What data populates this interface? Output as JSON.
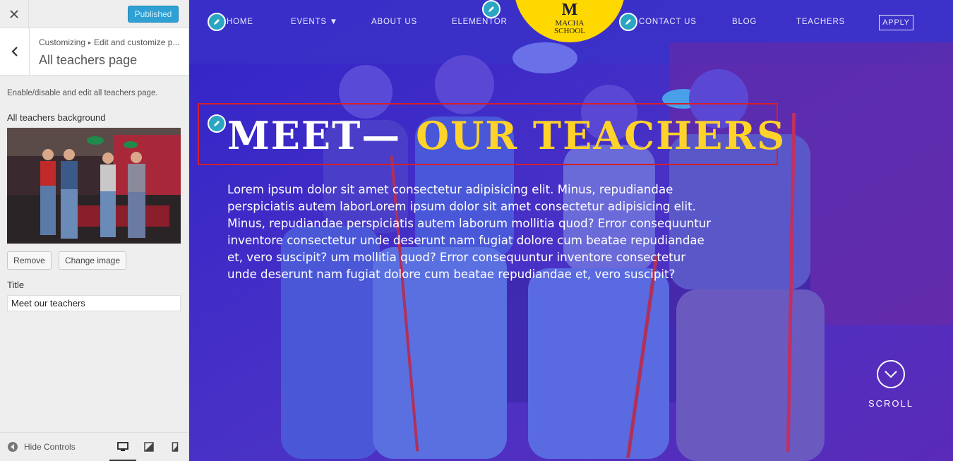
{
  "customizer": {
    "close_icon": "close-icon",
    "publish_label": "Published",
    "breadcrumb_root": "Customizing",
    "breadcrumb_current": "Edit and customize p...",
    "section_title": "All teachers page",
    "description": "Enable/disable and edit all teachers page.",
    "background_label": "All teachers background",
    "remove_label": "Remove",
    "change_label": "Change image",
    "title_label": "Title",
    "title_value": "Meet our teachers",
    "hide_controls_label": "Hide Controls",
    "devices": [
      "desktop",
      "tablet",
      "mobile"
    ]
  },
  "site": {
    "nav": {
      "home": "HOME",
      "events": "EVENTS ▼",
      "about": "ABOUT US",
      "elementor": "ELEMENTOR",
      "contact": "CONTACT US",
      "blog": "BLOG",
      "teachers": "TEACHERS",
      "apply": "APPLY"
    },
    "logo": {
      "letter": "M",
      "line1": "MACHA",
      "line2": "SCHOOL"
    },
    "heading_white": "MEET— ",
    "heading_yellow": "OUR TEACHERS",
    "body": "Lorem ipsum dolor sit amet consectetur adipisicing elit. Minus, repudiandae perspiciatis autem laborLorem ipsum dolor sit amet consectetur adipisicing elit. Minus, repudiandae perspiciatis autem laborum mollitia quod? Error consequuntur inventore consectetur unde deserunt nam fugiat dolore cum beatae repudiandae et, vero suscipit? um mollitia quod? Error consequuntur inventore consectetur unde deserunt nam fugiat dolore cum beatae repudiandae et, vero suscipit?",
    "scroll_label": "SCROLL"
  },
  "colors": {
    "overlay": "#3a2fd0",
    "accent_yellow": "#ffd32a",
    "publish_blue": "#2ea0d3",
    "edit_pin": "#2aa6c2",
    "selection_red": "#d4202a"
  }
}
